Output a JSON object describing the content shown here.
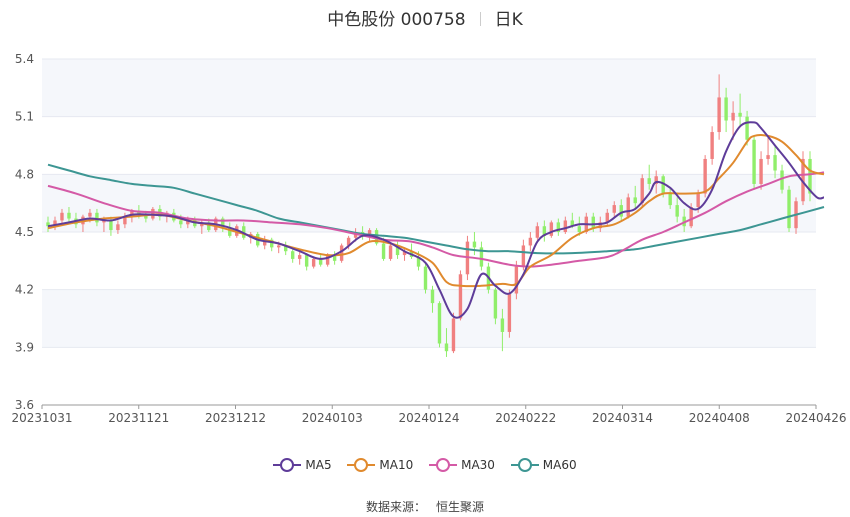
{
  "header": {
    "stock": "中色股份 000758",
    "period": "日K"
  },
  "source": {
    "label": "数据来源：",
    "value": "恒生聚源"
  },
  "colors": {
    "up": "#f08080",
    "down": "#90ee6a",
    "MA5": "#5e3c99",
    "MA10": "#e08a2e",
    "MA30": "#d45aa6",
    "MA60": "#3d9693"
  },
  "chart_data": {
    "type": "candlestick",
    "ylim": [
      3.6,
      5.4
    ],
    "yticks": [
      "3.6",
      "3.9",
      "4.2",
      "4.5",
      "4.8",
      "5.1",
      "5.4"
    ],
    "xticks": [
      "20231031",
      "20231121",
      "20231212",
      "20240103",
      "20240124",
      "20240222",
      "20240314",
      "20240408",
      "20240426"
    ],
    "legend": [
      "MA5",
      "MA10",
      "MA30",
      "MA60"
    ],
    "candles_ohlc": [
      [
        4.55,
        4.58,
        4.5,
        4.53
      ],
      [
        4.53,
        4.58,
        4.51,
        4.56
      ],
      [
        4.56,
        4.62,
        4.54,
        4.6
      ],
      [
        4.6,
        4.63,
        4.55,
        4.57
      ],
      [
        4.57,
        4.6,
        4.52,
        4.54
      ],
      [
        4.54,
        4.59,
        4.5,
        4.58
      ],
      [
        4.58,
        4.62,
        4.55,
        4.6
      ],
      [
        4.6,
        4.62,
        4.53,
        4.55
      ],
      [
        4.55,
        4.58,
        4.5,
        4.56
      ],
      [
        4.56,
        4.58,
        4.48,
        4.51
      ],
      [
        4.51,
        4.56,
        4.49,
        4.54
      ],
      [
        4.54,
        4.6,
        4.52,
        4.58
      ],
      [
        4.58,
        4.62,
        4.55,
        4.61
      ],
      [
        4.61,
        4.64,
        4.57,
        4.59
      ],
      [
        4.59,
        4.61,
        4.55,
        4.57
      ],
      [
        4.57,
        4.63,
        4.56,
        4.62
      ],
      [
        4.62,
        4.64,
        4.56,
        4.58
      ],
      [
        4.58,
        4.61,
        4.55,
        4.6
      ],
      [
        4.6,
        4.62,
        4.55,
        4.56
      ],
      [
        4.56,
        4.59,
        4.52,
        4.54
      ],
      [
        4.54,
        4.58,
        4.52,
        4.57
      ],
      [
        4.57,
        4.58,
        4.52,
        4.53
      ],
      [
        4.53,
        4.56,
        4.49,
        4.55
      ],
      [
        4.55,
        4.57,
        4.5,
        4.51
      ],
      [
        4.51,
        4.58,
        4.5,
        4.57
      ],
      [
        4.57,
        4.58,
        4.5,
        4.52
      ],
      [
        4.52,
        4.55,
        4.47,
        4.48
      ],
      [
        4.48,
        4.54,
        4.47,
        4.53
      ],
      [
        4.53,
        4.55,
        4.46,
        4.47
      ],
      [
        4.47,
        4.5,
        4.44,
        4.49
      ],
      [
        4.49,
        4.5,
        4.42,
        4.43
      ],
      [
        4.43,
        4.48,
        4.41,
        4.46
      ],
      [
        4.46,
        4.47,
        4.4,
        4.42
      ],
      [
        4.42,
        4.45,
        4.39,
        4.43
      ],
      [
        4.43,
        4.45,
        4.38,
        4.4
      ],
      [
        4.4,
        4.41,
        4.34,
        4.36
      ],
      [
        4.36,
        4.4,
        4.33,
        4.38
      ],
      [
        4.38,
        4.39,
        4.3,
        4.32
      ],
      [
        4.32,
        4.37,
        4.31,
        4.36
      ],
      [
        4.36,
        4.38,
        4.32,
        4.33
      ],
      [
        4.33,
        4.39,
        4.32,
        4.38
      ],
      [
        4.38,
        4.4,
        4.33,
        4.35
      ],
      [
        4.35,
        4.44,
        4.34,
        4.43
      ],
      [
        4.43,
        4.48,
        4.41,
        4.47
      ],
      [
        4.47,
        4.52,
        4.45,
        4.5
      ],
      [
        4.5,
        4.53,
        4.46,
        4.48
      ],
      [
        4.48,
        4.52,
        4.45,
        4.51
      ],
      [
        4.51,
        4.52,
        4.43,
        4.44
      ],
      [
        4.44,
        4.47,
        4.35,
        4.36
      ],
      [
        4.36,
        4.44,
        4.35,
        4.43
      ],
      [
        4.43,
        4.45,
        4.36,
        4.38
      ],
      [
        4.38,
        4.42,
        4.35,
        4.4
      ],
      [
        4.4,
        4.44,
        4.36,
        4.37
      ],
      [
        4.37,
        4.4,
        4.3,
        4.32
      ],
      [
        4.32,
        4.34,
        4.18,
        4.2
      ],
      [
        4.2,
        4.22,
        4.08,
        4.13
      ],
      [
        4.13,
        4.14,
        3.9,
        3.92
      ],
      [
        3.92,
        4.0,
        3.85,
        3.88
      ],
      [
        3.88,
        4.08,
        3.87,
        4.05
      ],
      [
        4.05,
        4.3,
        4.04,
        4.28
      ],
      [
        4.28,
        4.48,
        4.25,
        4.45
      ],
      [
        4.45,
        4.5,
        4.38,
        4.42
      ],
      [
        4.42,
        4.45,
        4.3,
        4.32
      ],
      [
        4.32,
        4.34,
        4.18,
        4.2
      ],
      [
        4.2,
        4.21,
        4.02,
        4.05
      ],
      [
        4.05,
        4.1,
        3.88,
        3.98
      ],
      [
        3.98,
        4.2,
        3.95,
        4.18
      ],
      [
        4.18,
        4.35,
        4.15,
        4.32
      ],
      [
        4.32,
        4.46,
        4.3,
        4.43
      ],
      [
        4.43,
        4.5,
        4.4,
        4.47
      ],
      [
        4.47,
        4.55,
        4.46,
        4.53
      ],
      [
        4.53,
        4.56,
        4.45,
        4.48
      ],
      [
        4.48,
        4.56,
        4.47,
        4.55
      ],
      [
        4.55,
        4.57,
        4.48,
        4.5
      ],
      [
        4.5,
        4.58,
        4.49,
        4.56
      ],
      [
        4.56,
        4.6,
        4.52,
        4.53
      ],
      [
        4.53,
        4.58,
        4.48,
        4.5
      ],
      [
        4.5,
        4.6,
        4.49,
        4.58
      ],
      [
        4.58,
        4.6,
        4.5,
        4.52
      ],
      [
        4.52,
        4.58,
        4.5,
        4.55
      ],
      [
        4.55,
        4.62,
        4.53,
        4.6
      ],
      [
        4.6,
        4.66,
        4.58,
        4.64
      ],
      [
        4.64,
        4.67,
        4.56,
        4.58
      ],
      [
        4.58,
        4.7,
        4.57,
        4.68
      ],
      [
        4.68,
        4.74,
        4.62,
        4.65
      ],
      [
        4.65,
        4.8,
        4.63,
        4.78
      ],
      [
        4.78,
        4.85,
        4.72,
        4.75
      ],
      [
        4.75,
        4.82,
        4.7,
        4.79
      ],
      [
        4.79,
        4.8,
        4.68,
        4.7
      ],
      [
        4.7,
        4.73,
        4.62,
        4.64
      ],
      [
        4.64,
        4.68,
        4.55,
        4.58
      ],
      [
        4.58,
        4.62,
        4.5,
        4.53
      ],
      [
        4.53,
        4.65,
        4.52,
        4.63
      ],
      [
        4.63,
        4.72,
        4.6,
        4.7
      ],
      [
        4.7,
        4.9,
        4.68,
        4.88
      ],
      [
        4.88,
        5.05,
        4.85,
        5.02
      ],
      [
        5.02,
        5.32,
        4.98,
        5.2
      ],
      [
        5.2,
        5.25,
        5.02,
        5.08
      ],
      [
        5.08,
        5.18,
        4.98,
        5.12
      ],
      [
        5.12,
        5.22,
        5.05,
        5.1
      ],
      [
        5.1,
        5.13,
        4.95,
        4.98
      ],
      [
        4.98,
        5.0,
        4.72,
        4.75
      ],
      [
        4.75,
        4.92,
        4.72,
        4.88
      ],
      [
        4.88,
        5.0,
        4.85,
        4.9
      ],
      [
        4.9,
        4.95,
        4.78,
        4.82
      ],
      [
        4.82,
        4.85,
        4.7,
        4.72
      ],
      [
        4.72,
        4.74,
        4.5,
        4.52
      ],
      [
        4.52,
        4.68,
        4.49,
        4.66
      ],
      [
        4.66,
        4.92,
        4.64,
        4.88
      ],
      [
        4.88,
        4.92,
        4.66,
        4.7
      ]
    ],
    "MA5": [
      [
        0,
        4.53
      ],
      [
        3,
        4.55
      ],
      [
        6,
        4.57
      ],
      [
        9,
        4.56
      ],
      [
        12,
        4.59
      ],
      [
        15,
        4.59
      ],
      [
        18,
        4.58
      ],
      [
        21,
        4.55
      ],
      [
        24,
        4.54
      ],
      [
        27,
        4.51
      ],
      [
        30,
        4.46
      ],
      [
        33,
        4.44
      ],
      [
        36,
        4.4
      ],
      [
        39,
        4.36
      ],
      [
        42,
        4.4
      ],
      [
        45,
        4.48
      ],
      [
        48,
        4.46
      ],
      [
        51,
        4.4
      ],
      [
        54,
        4.34
      ],
      [
        56,
        4.2
      ],
      [
        58,
        4.06
      ],
      [
        60,
        4.1
      ],
      [
        62,
        4.28
      ],
      [
        64,
        4.22
      ],
      [
        66,
        4.18
      ],
      [
        68,
        4.28
      ],
      [
        70,
        4.45
      ],
      [
        72,
        4.5
      ],
      [
        74,
        4.52
      ],
      [
        76,
        4.54
      ],
      [
        78,
        4.54
      ],
      [
        80,
        4.55
      ],
      [
        82,
        4.6
      ],
      [
        84,
        4.62
      ],
      [
        86,
        4.7
      ],
      [
        87,
        4.76
      ],
      [
        89,
        4.73
      ],
      [
        91,
        4.65
      ],
      [
        93,
        4.62
      ],
      [
        95,
        4.72
      ],
      [
        97,
        4.92
      ],
      [
        99,
        5.05
      ],
      [
        101,
        5.07
      ],
      [
        102,
        5.04
      ],
      [
        104,
        4.95
      ],
      [
        106,
        4.86
      ],
      [
        108,
        4.76
      ],
      [
        110,
        4.68
      ],
      [
        111,
        4.68
      ]
    ],
    "MA10": [
      [
        0,
        4.52
      ],
      [
        4,
        4.55
      ],
      [
        8,
        4.57
      ],
      [
        12,
        4.58
      ],
      [
        16,
        4.59
      ],
      [
        20,
        4.56
      ],
      [
        24,
        4.53
      ],
      [
        28,
        4.49
      ],
      [
        32,
        4.45
      ],
      [
        36,
        4.41
      ],
      [
        40,
        4.38
      ],
      [
        43,
        4.39
      ],
      [
        46,
        4.45
      ],
      [
        49,
        4.44
      ],
      [
        52,
        4.4
      ],
      [
        55,
        4.34
      ],
      [
        57,
        4.24
      ],
      [
        59,
        4.22
      ],
      [
        62,
        4.22
      ],
      [
        65,
        4.23
      ],
      [
        67,
        4.23
      ],
      [
        69,
        4.32
      ],
      [
        72,
        4.38
      ],
      [
        75,
        4.47
      ],
      [
        78,
        4.52
      ],
      [
        81,
        4.54
      ],
      [
        84,
        4.6
      ],
      [
        86,
        4.66
      ],
      [
        88,
        4.7
      ],
      [
        91,
        4.7
      ],
      [
        94,
        4.71
      ],
      [
        96,
        4.78
      ],
      [
        98,
        4.86
      ],
      [
        100,
        4.97
      ],
      [
        101,
        5.0
      ],
      [
        103,
        5.0
      ],
      [
        105,
        4.97
      ],
      [
        107,
        4.9
      ],
      [
        109,
        4.82
      ],
      [
        111,
        4.8
      ]
    ],
    "MA30": [
      [
        0,
        4.74
      ],
      [
        4,
        4.7
      ],
      [
        8,
        4.65
      ],
      [
        12,
        4.61
      ],
      [
        16,
        4.6
      ],
      [
        20,
        4.57
      ],
      [
        24,
        4.56
      ],
      [
        28,
        4.56
      ],
      [
        32,
        4.55
      ],
      [
        36,
        4.54
      ],
      [
        40,
        4.52
      ],
      [
        44,
        4.49
      ],
      [
        48,
        4.46
      ],
      [
        52,
        4.45
      ],
      [
        55,
        4.42
      ],
      [
        58,
        4.38
      ],
      [
        62,
        4.36
      ],
      [
        66,
        4.33
      ],
      [
        69,
        4.32
      ],
      [
        72,
        4.33
      ],
      [
        76,
        4.35
      ],
      [
        80,
        4.37
      ],
      [
        82,
        4.4
      ],
      [
        85,
        4.46
      ],
      [
        88,
        4.5
      ],
      [
        91,
        4.55
      ],
      [
        94,
        4.6
      ],
      [
        97,
        4.66
      ],
      [
        100,
        4.71
      ],
      [
        103,
        4.75
      ],
      [
        106,
        4.79
      ],
      [
        109,
        4.8
      ],
      [
        111,
        4.81
      ]
    ],
    "MA60": [
      [
        0,
        4.85
      ],
      [
        3,
        4.82
      ],
      [
        6,
        4.79
      ],
      [
        9,
        4.77
      ],
      [
        12,
        4.75
      ],
      [
        15,
        4.74
      ],
      [
        18,
        4.73
      ],
      [
        21,
        4.7
      ],
      [
        24,
        4.67
      ],
      [
        27,
        4.64
      ],
      [
        30,
        4.61
      ],
      [
        33,
        4.57
      ],
      [
        36,
        4.55
      ],
      [
        39,
        4.53
      ],
      [
        42,
        4.51
      ],
      [
        45,
        4.49
      ],
      [
        48,
        4.48
      ],
      [
        51,
        4.47
      ],
      [
        54,
        4.45
      ],
      [
        57,
        4.43
      ],
      [
        60,
        4.41
      ],
      [
        63,
        4.4
      ],
      [
        66,
        4.4
      ],
      [
        70,
        4.39
      ],
      [
        75,
        4.39
      ],
      [
        80,
        4.4
      ],
      [
        84,
        4.41
      ],
      [
        87,
        4.43
      ],
      [
        90,
        4.45
      ],
      [
        93,
        4.47
      ],
      [
        96,
        4.49
      ],
      [
        99,
        4.51
      ],
      [
        102,
        4.54
      ],
      [
        105,
        4.57
      ],
      [
        108,
        4.6
      ],
      [
        111,
        4.63
      ]
    ]
  }
}
